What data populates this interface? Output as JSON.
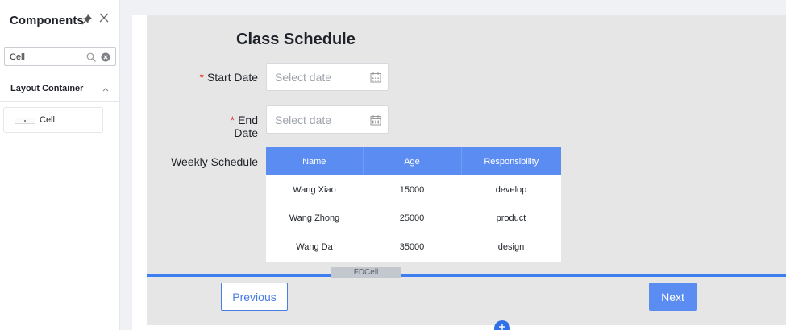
{
  "panel": {
    "title": "Components",
    "search": {
      "value": "Cell",
      "placeholder": ""
    },
    "group": {
      "label": "Layout Container"
    },
    "items": [
      {
        "label": "Cell"
      }
    ]
  },
  "form": {
    "title": "Class Schedule",
    "required_mark": "*",
    "start_date": {
      "label": "Start Date",
      "placeholder": "Select date"
    },
    "end_date": {
      "label": "End Date",
      "placeholder": "Select date"
    },
    "schedule_label": "Weekly Schedule",
    "table": {
      "columns": [
        "Name",
        "Age",
        "Responsibility"
      ],
      "rows": [
        [
          "Wang Xiao",
          "15000",
          "develop"
        ],
        [
          "Wang Zhong",
          "25000",
          "product"
        ],
        [
          "Wang Da",
          "35000",
          "design"
        ]
      ]
    },
    "cell_tag": "FDCell",
    "previous_label": "Previous",
    "next_label": "Next"
  },
  "icons": [
    "pin-icon",
    "close-icon",
    "search-icon",
    "clear-icon",
    "chevron-up-icon",
    "calendar-icon",
    "add-icon"
  ],
  "colors": {
    "primary": "#5b8cf2",
    "required": "#e23b32",
    "selection": "#3d7ff0"
  }
}
